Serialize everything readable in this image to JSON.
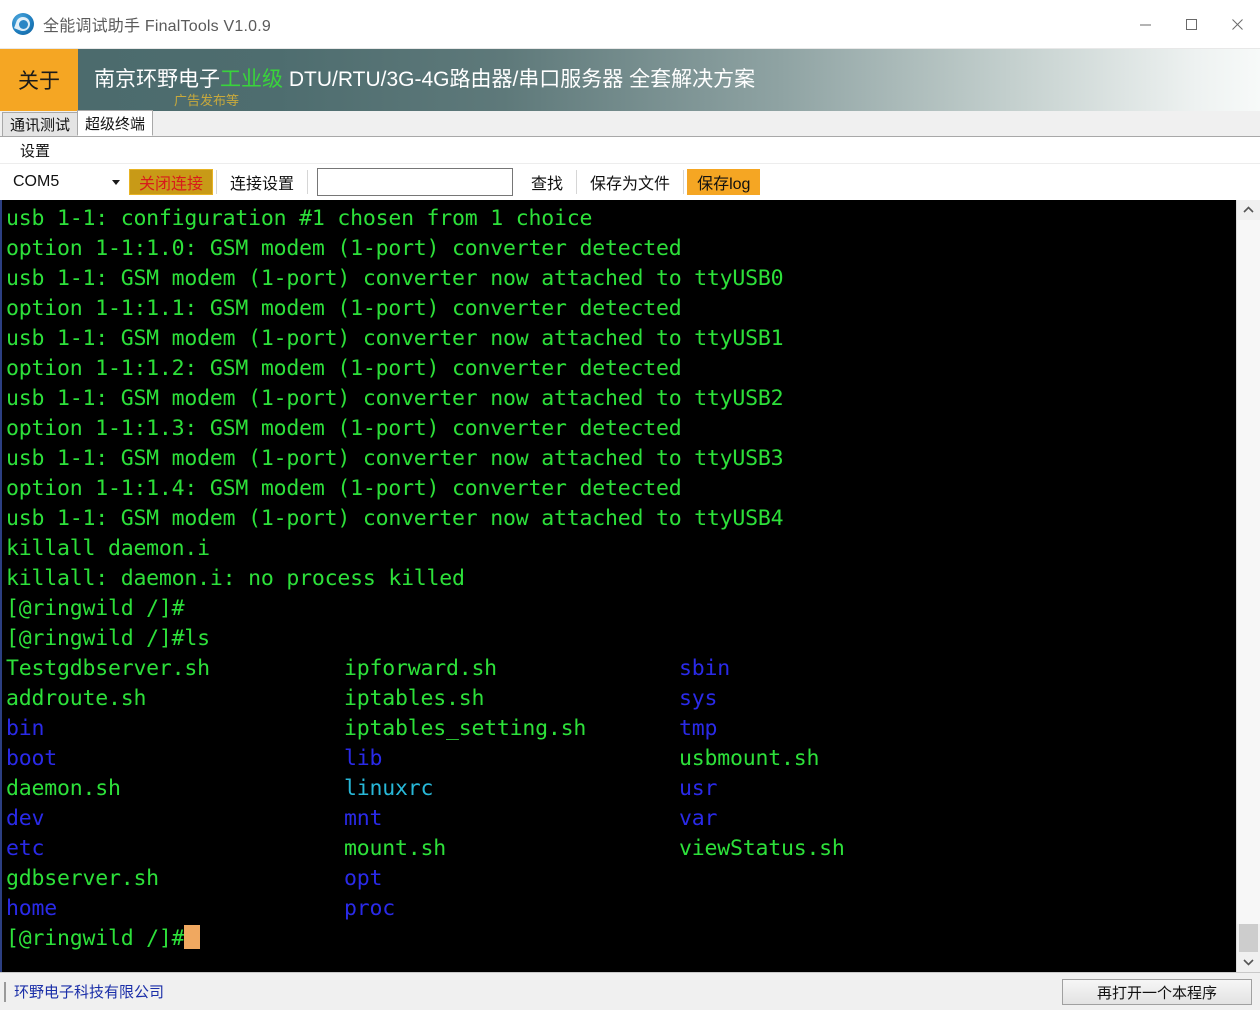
{
  "window": {
    "title": "全能调试助手 FinalTools V1.0.9",
    "icon": "app-logo-icon",
    "controls": {
      "minimize": "minimize-icon",
      "restore": "restore-icon",
      "maximize": "maximize-icon",
      "close": "close-icon"
    }
  },
  "banner": {
    "about_label": "关于",
    "main_prefix": "南京环野电子",
    "main_highlight": "工业级",
    "main_suffix": " DTU/RTU/3G-4G路由器/串口服务器 全套解决方案",
    "sub_label": "广告发布等",
    "highlight_color": "#39d43b",
    "about_bg": "#f5a623"
  },
  "tabs": [
    {
      "label": "通讯测试",
      "active": false
    },
    {
      "label": "超级终端",
      "active": true
    }
  ],
  "menu": {
    "settings_label": "设置"
  },
  "toolbar": {
    "port_value": "COM5",
    "caret_icon": "chevron-down-icon",
    "disconnect_label": "关闭连接",
    "connection_settings_label": "连接设置",
    "find_input_value": "",
    "find_input_placeholder": "",
    "find_label": "查找",
    "save_file_label": "保存为文件",
    "save_log_label": "保存log",
    "disconnect_bg": "#c89a17",
    "disconnect_fg": "#d81b1b",
    "save_log_bg": "#f5a623"
  },
  "terminal": {
    "fg_color": "#2de03a",
    "bg_color": "#000000",
    "dir_color": "#2a2ae8",
    "link_color": "#28b8d8",
    "cursor_color": "#f0a860",
    "lines": [
      "usb 1-1: configuration #1 chosen from 1 choice",
      "option 1-1:1.0: GSM modem (1-port) converter detected",
      "usb 1-1: GSM modem (1-port) converter now attached to ttyUSB0",
      "option 1-1:1.1: GSM modem (1-port) converter detected",
      "usb 1-1: GSM modem (1-port) converter now attached to ttyUSB1",
      "option 1-1:1.2: GSM modem (1-port) converter detected",
      "usb 1-1: GSM modem (1-port) converter now attached to ttyUSB2",
      "option 1-1:1.3: GSM modem (1-port) converter detected",
      "usb 1-1: GSM modem (1-port) converter now attached to ttyUSB3",
      "option 1-1:1.4: GSM modem (1-port) converter detected",
      "usb 1-1: GSM modem (1-port) converter now attached to ttyUSB4",
      "killall daemon.i",
      "killall: daemon.i: no process killed",
      "[@ringwild /]#",
      "[@ringwild /]#ls"
    ],
    "listing_rows": [
      [
        {
          "name": "Testgdbserver.sh",
          "kind": "file"
        },
        {
          "name": "ipforward.sh",
          "kind": "file"
        },
        {
          "name": "sbin",
          "kind": "dir"
        }
      ],
      [
        {
          "name": "addroute.sh",
          "kind": "file"
        },
        {
          "name": "iptables.sh",
          "kind": "file"
        },
        {
          "name": "sys",
          "kind": "dir"
        }
      ],
      [
        {
          "name": "bin",
          "kind": "dir"
        },
        {
          "name": "iptables_setting.sh",
          "kind": "file"
        },
        {
          "name": "tmp",
          "kind": "dir"
        }
      ],
      [
        {
          "name": "boot",
          "kind": "dir"
        },
        {
          "name": "lib",
          "kind": "dir"
        },
        {
          "name": "usbmount.sh",
          "kind": "file"
        }
      ],
      [
        {
          "name": "daemon.sh",
          "kind": "file"
        },
        {
          "name": "linuxrc",
          "kind": "link"
        },
        {
          "name": "usr",
          "kind": "dir"
        }
      ],
      [
        {
          "name": "dev",
          "kind": "dir"
        },
        {
          "name": "mnt",
          "kind": "dir"
        },
        {
          "name": "var",
          "kind": "dir"
        }
      ],
      [
        {
          "name": "etc",
          "kind": "dir"
        },
        {
          "name": "mount.sh",
          "kind": "file"
        },
        {
          "name": "viewStatus.sh",
          "kind": "file"
        }
      ],
      [
        {
          "name": "gdbserver.sh",
          "kind": "file"
        },
        {
          "name": "opt",
          "kind": "dir"
        },
        {
          "name": "",
          "kind": "file"
        }
      ],
      [
        {
          "name": "home",
          "kind": "dir"
        },
        {
          "name": "proc",
          "kind": "dir"
        },
        {
          "name": "",
          "kind": "file"
        }
      ]
    ],
    "prompt": "[@ringwild /]#"
  },
  "scrollbar": {
    "up_icon": "chevron-up-icon",
    "down_icon": "chevron-down-icon"
  },
  "statusbar": {
    "company_label": "环野电子科技有限公司",
    "open_another_label": "再打开一个本程序"
  }
}
